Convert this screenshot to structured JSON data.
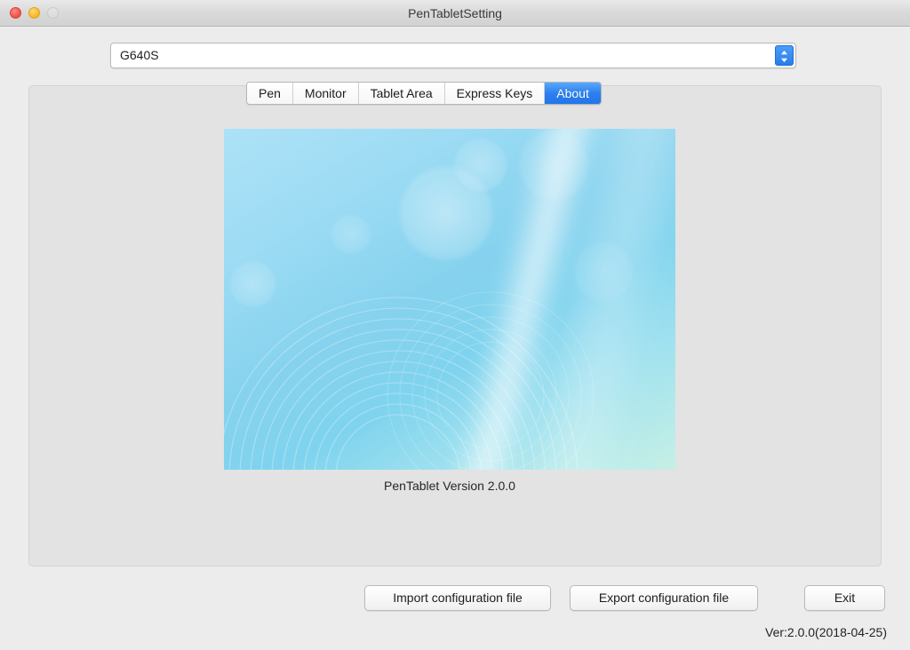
{
  "window": {
    "title": "PenTabletSetting",
    "traffic_lights": [
      {
        "name": "close",
        "color": "#f05a52",
        "enabled": true
      },
      {
        "name": "minimize",
        "color": "#fcbc2e",
        "enabled": true
      },
      {
        "name": "zoom",
        "color": "#dcdcdc",
        "enabled": false
      }
    ]
  },
  "device_selector": {
    "value": "G640S",
    "icon": "chevron-up-down-icon",
    "accent": "#2a7de8"
  },
  "tabs": [
    {
      "label": "Pen",
      "selected": false
    },
    {
      "label": "Monitor",
      "selected": false
    },
    {
      "label": "Tablet Area",
      "selected": false
    },
    {
      "label": "Express Keys",
      "selected": false
    },
    {
      "label": "About",
      "selected": true
    }
  ],
  "about": {
    "splash_alt": "pen-tablet-splash-image",
    "version_caption": "PenTablet Version  2.0.0"
  },
  "footer": {
    "import_label": "Import configuration file",
    "export_label": "Export configuration file",
    "exit_label": "Exit",
    "version_text": "Ver:2.0.0(2018-04-25)"
  },
  "colors": {
    "window_background": "#ececec",
    "panel_background": "#e3e3e3",
    "selected_tab": "#2c7ff0",
    "splash_light": "#ade2f7",
    "splash_dark": "#7fd3ee",
    "splash_teal": "#c6efe6"
  }
}
